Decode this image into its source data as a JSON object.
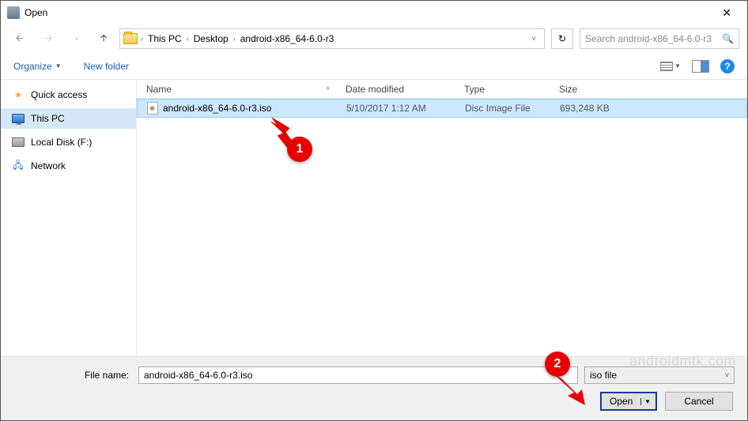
{
  "window": {
    "title": "Open"
  },
  "nav": {
    "crumbs": [
      "This PC",
      "Desktop",
      "android-x86_64-6.0-r3"
    ],
    "search_placeholder": "Search android-x86_64-6.0-r3"
  },
  "toolbar": {
    "organize": "Organize",
    "newfolder": "New folder"
  },
  "sidebar": {
    "items": [
      {
        "label": "Quick access"
      },
      {
        "label": "This PC"
      },
      {
        "label": "Local Disk (F:)"
      },
      {
        "label": "Network"
      }
    ]
  },
  "columns": {
    "name": "Name",
    "date": "Date modified",
    "type": "Type",
    "size": "Size"
  },
  "files": [
    {
      "name": "android-x86_64-6.0-r3.iso",
      "date": "5/10/2017 1:12 AM",
      "type": "Disc Image File",
      "size": "693,248 KB"
    }
  ],
  "bottom": {
    "filename_label": "File name:",
    "filename_value": "android-x86_64-6.0-r3.iso",
    "filter": "iso file",
    "open": "Open",
    "cancel": "Cancel"
  },
  "annotations": {
    "badge1": "1",
    "badge2": "2",
    "watermark": "androidmtk.com"
  }
}
